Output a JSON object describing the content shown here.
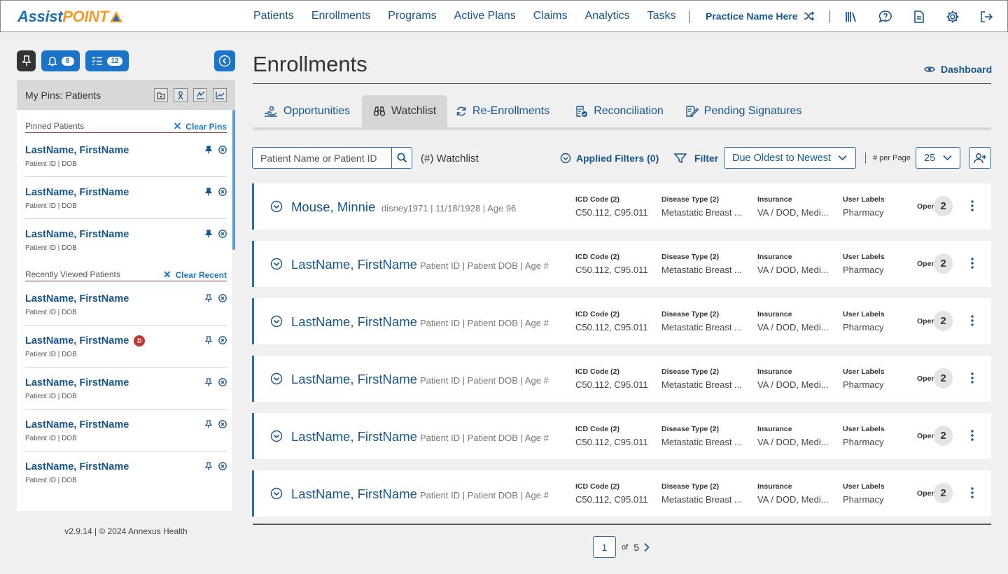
{
  "header": {
    "logo_part1": "Assist",
    "logo_part2": "POINT",
    "nav": [
      "Patients",
      "Enrollments",
      "Programs",
      "Active Plans",
      "Claims",
      "Analytics",
      "Tasks"
    ],
    "practice_name": "Practice Name Here",
    "icons": [
      "library-icon",
      "help-chat-icon",
      "document-icon",
      "settings-gear-icon",
      "logout-icon"
    ]
  },
  "sidebar": {
    "notifications_count": "8",
    "tasks_count": "12",
    "panel_title": "My Pins: Patients",
    "pinned_heading": "Pinned Patients",
    "clear_pins": "Clear Pins",
    "recent_heading": "Recently Viewed Patients",
    "clear_recent": "Clear Recent",
    "pinned": [
      {
        "name": "LastName, FirstName",
        "meta": "Patient ID  |  DOB"
      },
      {
        "name": "LastName, FirstName",
        "meta": "Patient ID  |  DOB"
      },
      {
        "name": "LastName, FirstName",
        "meta": "Patient ID  |  DOB"
      }
    ],
    "recent": [
      {
        "name": "LastName, FirstName",
        "meta": "Patient ID  |  DOB",
        "badge": ""
      },
      {
        "name": "LastName, FirstName",
        "meta": "Patient ID  |  DOB",
        "badge": "D"
      },
      {
        "name": "LastName, FirstName",
        "meta": "Patient ID  |  DOB",
        "badge": ""
      },
      {
        "name": "LastName, FirstName",
        "meta": "Patient ID  |  DOB",
        "badge": ""
      },
      {
        "name": "LastName, FirstName",
        "meta": "Patient ID  |  DOB",
        "badge": ""
      }
    ],
    "version": "v2.9.14  |  © 2024 Annexus Health"
  },
  "main": {
    "title": "Enrollments",
    "dashboard_link": "Dashboard",
    "tabs": [
      "Opportunities",
      "Watchlist",
      "Re-Enrollments",
      "Reconciliation",
      "Pending Signatures"
    ],
    "active_tab": "Watchlist",
    "search_placeholder": "Patient Name or Patient ID",
    "watchlist_count_label": "(#) Watchlist",
    "applied_filters": "Applied Filters (0)",
    "filter_label": "Filter",
    "sort_value": "Due Oldest to Newest",
    "per_page_label": "# per Page",
    "per_page_value": "25",
    "field_labels": {
      "icd": "ICD Code (2)",
      "disease": "Disease Type (2)",
      "insurance": "Insurance",
      "labels": "User Labels",
      "open": "Open"
    },
    "rows": [
      {
        "name": "Mouse, Minnie",
        "meta": "disney1971 | 11/18/1928 | Age 96",
        "icd": "C50.112, C95.011",
        "disease": "Metastatic Breast ...",
        "insurance": "VA / DOD, Medi...",
        "labels": "Pharmacy",
        "open": "2"
      },
      {
        "name": "LastName, FirstName",
        "meta": "Patient ID   |   Patient DOB   |   Age #",
        "icd": "C50.112, C95.011",
        "disease": "Metastatic Breast ...",
        "insurance": "VA / DOD, Medi...",
        "labels": "Pharmacy",
        "open": "2"
      },
      {
        "name": "LastName, FirstName",
        "meta": "Patient ID   |   Patient DOB   |   Age #",
        "icd": "C50.112, C95.011",
        "disease": "Metastatic Breast ...",
        "insurance": "VA / DOD, Medi...",
        "labels": "Pharmacy",
        "open": "2"
      },
      {
        "name": "LastName, FirstName",
        "meta": "Patient ID   |   Patient DOB   |   Age #",
        "icd": "C50.112, C95.011",
        "disease": "Metastatic Breast ...",
        "insurance": "VA / DOD, Medi...",
        "labels": "Pharmacy",
        "open": "2"
      },
      {
        "name": "LastName, FirstName",
        "meta": "Patient ID   |   Patient DOB   |   Age #",
        "icd": "C50.112, C95.011",
        "disease": "Metastatic Breast ...",
        "insurance": "VA / DOD, Medi...",
        "labels": "Pharmacy",
        "open": "2"
      },
      {
        "name": "LastName, FirstName",
        "meta": "Patient ID   |   Patient DOB   |   Age #",
        "icd": "C50.112, C95.011",
        "disease": "Metastatic Breast ...",
        "insurance": "VA / DOD, Medi...",
        "labels": "Pharmacy",
        "open": "2"
      }
    ],
    "pagination": {
      "current": "1",
      "of_label": "of",
      "total": "5"
    }
  },
  "colors": {
    "brand_blue": "#17558f",
    "accent_blue": "#1b74c8",
    "logo_orange": "#f39a2b",
    "badge_red": "#c4322d"
  }
}
